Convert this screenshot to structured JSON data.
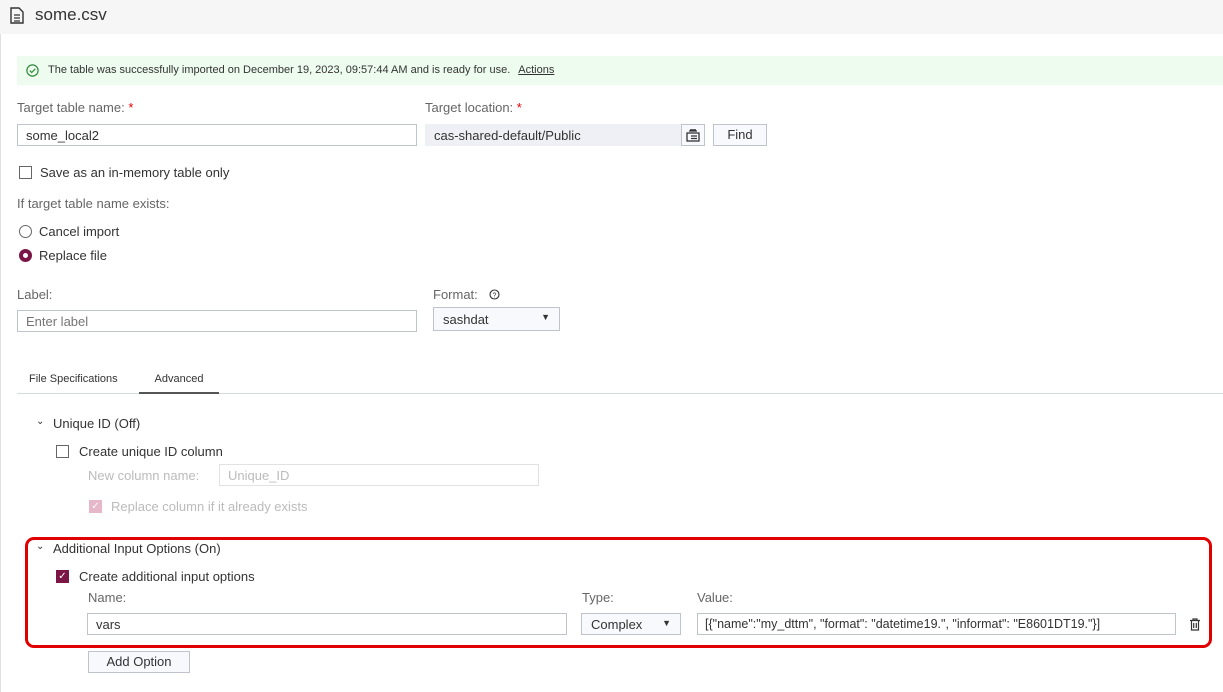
{
  "header": {
    "title": "some.csv",
    "icon": "document-icon"
  },
  "banner": {
    "message": "The table was successfully imported on December 19, 2023, 09:57:44 AM and is ready for use.",
    "actions_link": "Actions"
  },
  "target_table": {
    "label": "Target table name:",
    "required": "*",
    "value": "some_local2"
  },
  "target_location": {
    "label": "Target location:",
    "required": "*",
    "value": "cas-shared-default/Public",
    "find_button": "Find"
  },
  "in_memory": {
    "label": "Save as an in-memory table only",
    "checked": false
  },
  "if_exists": {
    "label": "If target table name exists:",
    "options": [
      {
        "label": "Cancel import",
        "selected": false
      },
      {
        "label": "Replace file",
        "selected": true
      }
    ]
  },
  "label_field": {
    "label": "Label:",
    "placeholder": "Enter label",
    "value": ""
  },
  "format": {
    "label": "Format:",
    "value": "sashdat"
  },
  "tabs": [
    {
      "label": "File Specifications",
      "active": false
    },
    {
      "label": "Advanced",
      "active": true
    }
  ],
  "unique_id": {
    "header": "Unique ID (Off)",
    "create_label": "Create unique ID column",
    "new_col_label": "New column name:",
    "new_col_value": "Unique_ID",
    "replace_label": "Replace column if it already exists"
  },
  "additional": {
    "header": "Additional Input Options (On)",
    "create_label": "Create additional input options",
    "name_label": "Name:",
    "type_label": "Type:",
    "value_label": "Value:",
    "name_value": "vars",
    "type_value": "Complex",
    "value_value": "[{\"name\":\"my_dttm\", \"format\": \"datetime19.\", \"informat\": \"E8601DT19.\"}]",
    "add_button": "Add Option"
  },
  "colors": {
    "accent": "#7b1746",
    "highlight": "#e10000",
    "banner_bg": "#eefbef"
  }
}
